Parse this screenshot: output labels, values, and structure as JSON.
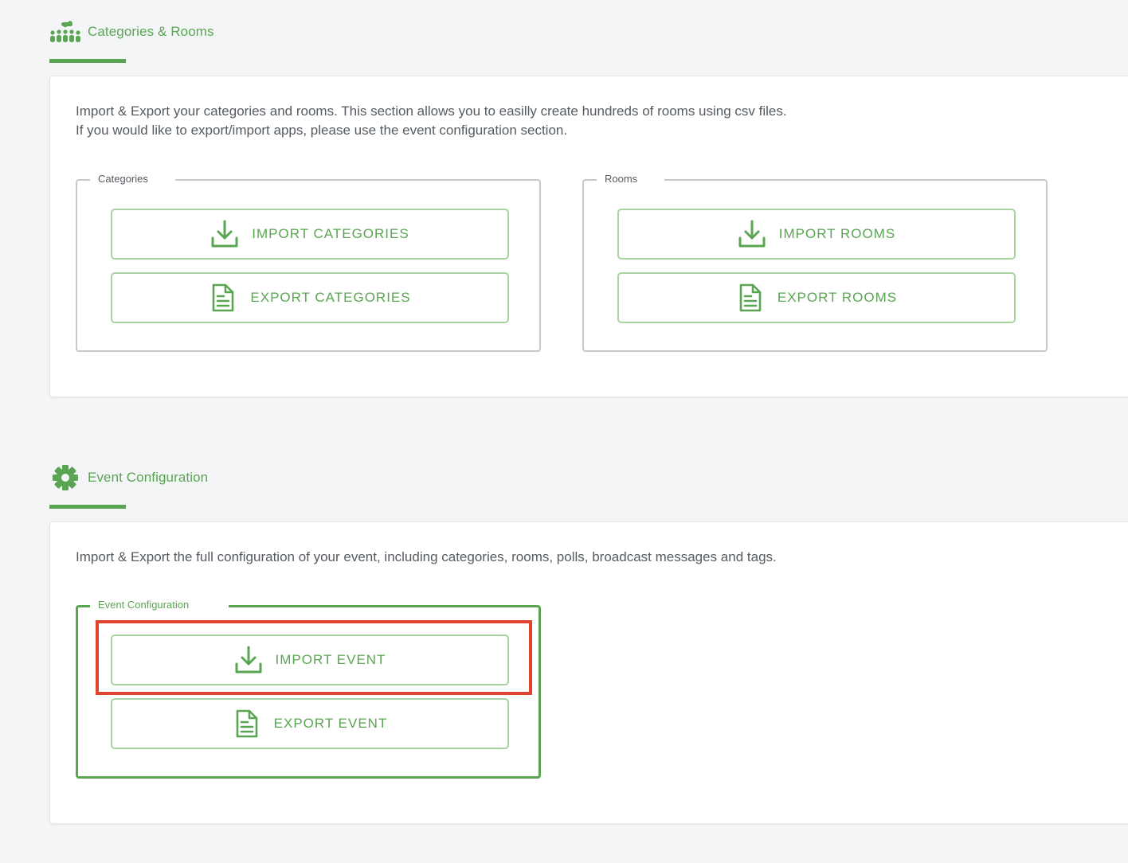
{
  "sections": {
    "categories_rooms": {
      "title": "Categories & Rooms",
      "icon": "people-group-icon",
      "description": [
        "Import & Export your categories and rooms. This section allows you to easilly create hundreds of rooms using csv files.",
        "If you would like to export/import apps, please use the event configuration section."
      ],
      "categories": {
        "legend": "Categories",
        "import_label": "IMPORT CATEGORIES",
        "export_label": "EXPORT CATEGORIES"
      },
      "rooms": {
        "legend": "Rooms",
        "import_label": "IMPORT ROOMS",
        "export_label": "EXPORT ROOMS"
      }
    },
    "event_configuration": {
      "title": "Event Configuration",
      "icon": "gear-icon",
      "description": "Import & Export the full configuration of your event, including categories, rooms, polls, broadcast messages and tags.",
      "group": {
        "legend": "Event Configuration",
        "import_label": "IMPORT EVENT",
        "export_label": "EXPORT EVENT"
      }
    }
  },
  "colors": {
    "accent": "#5aa552",
    "button_border": "#a9d4a2",
    "highlight": "#e0432f",
    "text": "#555b60",
    "background": "#f4f5f6"
  }
}
